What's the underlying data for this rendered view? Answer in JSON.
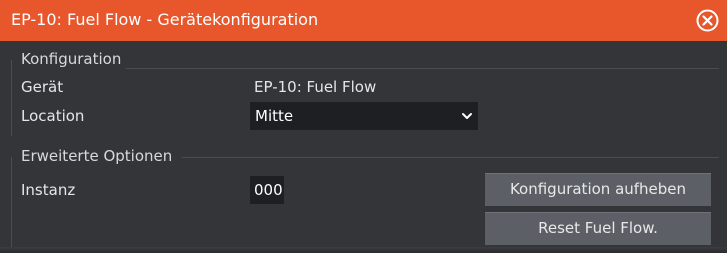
{
  "dialog": {
    "title": "EP-10: Fuel Flow - Gerätekonfiguration",
    "close_icon": "close-circle-icon",
    "accent_color": "#e8562c",
    "background_color": "#333539"
  },
  "configuration": {
    "group_label": "Konfiguration",
    "device_label": "Gerät",
    "device_value": "EP-10: Fuel Flow",
    "location_label": "Location",
    "location_value": "Mitte",
    "location_icon": "chevron-down-icon"
  },
  "advanced": {
    "group_label": "Erweiterte Optionen",
    "instance_label": "Instanz",
    "instance_value": "000",
    "unconfigure_button": "Konfiguration aufheben",
    "reset_button": "Reset Fuel Flow."
  }
}
